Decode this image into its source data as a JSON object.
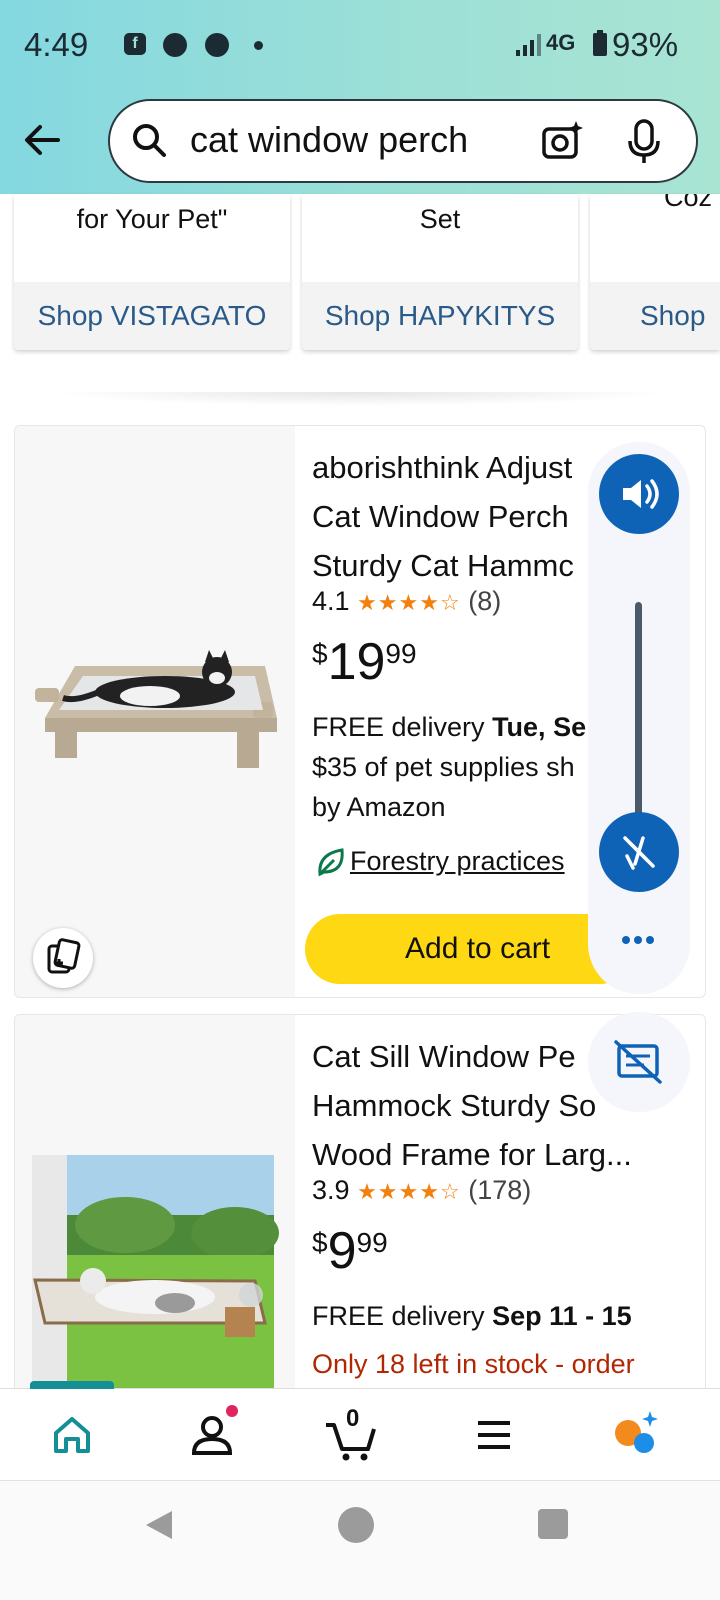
{
  "status_bar": {
    "time": "4:49",
    "network": "4G",
    "battery": "93%",
    "notification_icons": [
      "facebook-icon",
      "messenger-icon",
      "messenger-icon",
      "dot-icon"
    ]
  },
  "search": {
    "query": "cat window perch"
  },
  "shop_cards": [
    {
      "top_text": "for Your Pet\"",
      "link": "Shop VISTAGATO"
    },
    {
      "top_text": "Set",
      "link": "Shop HAPYKITYS"
    },
    {
      "top_text": "Coz",
      "link": "Shop"
    }
  ],
  "products": [
    {
      "title_lines": [
        "aborishthink Adjust",
        "Cat Window Perch",
        "Sturdy Cat Hammc"
      ],
      "rating": "4.1",
      "rating_value": 4.1,
      "stars": "★★★★☆",
      "review_count": "(8)",
      "price_currency": "$",
      "price_whole": "19",
      "price_fraction": "99",
      "delivery_prefix": "FREE delivery ",
      "delivery_date": "Tue, Se",
      "delivery_line2": "$35 of pet supplies sh",
      "delivery_line3": "by Amazon",
      "sustainability_link": "Forestry practices",
      "add_to_cart": "Add to cart"
    },
    {
      "title_lines": [
        "Cat Sill Window Pe",
        "Hammock Sturdy So",
        "Wood Frame for Larg..."
      ],
      "rating": "3.9",
      "rating_value": 3.9,
      "stars": "★★★★☆",
      "review_count": "(178)",
      "price_currency": "$",
      "price_whole": "9",
      "price_fraction": "99",
      "delivery_prefix": "FREE delivery ",
      "delivery_date": "Sep 11 - 15",
      "stock_warning": "Only 18 left in stock - order"
    }
  ],
  "bottom_nav": {
    "items": [
      "home-icon",
      "account-icon",
      "cart-icon",
      "menu-icon",
      "assistant-icon"
    ],
    "cart_count": "0"
  },
  "colors": {
    "header_gradient_start": "#84d8e0",
    "header_gradient_end": "#a9e4d3",
    "add_to_cart": "#ffd814",
    "star": "#f2800f",
    "link": "#2a5a88",
    "accessibility_blue": "#0f63b6",
    "stock_warning": "#b12704",
    "nav_active": "#158f96"
  }
}
